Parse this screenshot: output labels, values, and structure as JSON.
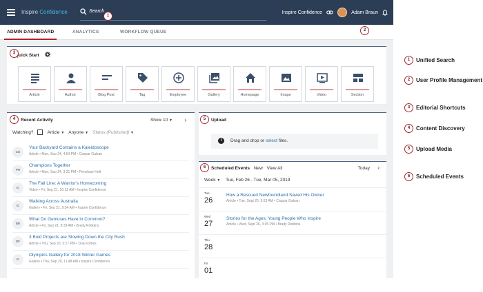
{
  "header": {
    "brand_name": "Inspire",
    "brand_accent": "Confidence",
    "search_placeholder": "Search",
    "site_name": "Inspire Confidence",
    "user_name": "Adam Braun"
  },
  "tabs": [
    {
      "label": "ADMIN DASHBOARD",
      "active": true
    },
    {
      "label": "ANALYTICS",
      "active": false
    },
    {
      "label": "WORKFLOW QUEUE",
      "active": false
    }
  ],
  "quick_start": {
    "title": "Quick Start",
    "tiles": [
      {
        "label": "Article",
        "icon": "article-icon"
      },
      {
        "label": "Author",
        "icon": "author-icon"
      },
      {
        "label": "Blog Post",
        "icon": "blog-post-icon"
      },
      {
        "label": "Tag",
        "icon": "tag-icon"
      },
      {
        "label": "Employee",
        "icon": "plus-circle-icon"
      },
      {
        "label": "Gallery",
        "icon": "gallery-icon"
      },
      {
        "label": "Homepage",
        "icon": "home-icon"
      },
      {
        "label": "Image",
        "icon": "image-icon"
      },
      {
        "label": "Video",
        "icon": "video-icon"
      },
      {
        "label": "Section",
        "icon": "section-icon"
      }
    ]
  },
  "recent_activity": {
    "title": "Recent Activity",
    "show_label": "Show 10",
    "filters": {
      "watching": "Watching?",
      "type": "Article",
      "who": "Anyone",
      "status": "Status (Published)"
    },
    "items": [
      {
        "initials": "CG",
        "title": "Your Backyard Contains a Kaleidoscope",
        "meta": "Article  •  Mon, Sep 24, 4:54 PM  •  Caspar Galvan"
      },
      {
        "initials": "PH",
        "title": "Champions Together",
        "meta": "Article  •  Mon, Sep 24, 3:21 PM  •  Penelope Holt"
      },
      {
        "initials": "IC",
        "title": "The Fall Line: A Warrior's Homecoming",
        "meta": "Video  •  Fri, Sep 21, 10:12 AM  •  Inspire Confidence"
      },
      {
        "initials": "IC",
        "title": "Walking Across Australia",
        "meta": "Gallery  •  Fri, Sep 21, 9:54 AM  •  Inspire Confidence"
      },
      {
        "initials": "BR",
        "title": "What Do Geniuses Have in Common?",
        "meta": "Article  •  Fri, Sep 21, 8:33 AM  •  Brady Robbins"
      },
      {
        "initials": "DF",
        "title": "3 Bold Projects are Slowing Down the City Rush",
        "meta": "Article  •  Thu, Sep 20, 2:17 PM  •  Dua Forbes"
      },
      {
        "initials": "IC",
        "title": "Olympics Gallery for 2018 Winter Games",
        "meta": "Gallery  •  Thu, Sep 20, 11:48 AM  •  Inspire Confidence"
      }
    ]
  },
  "upload": {
    "title": "Upload",
    "text_before": "Drag and drop or ",
    "link": "select",
    "text_after": " files."
  },
  "scheduled": {
    "title": "Scheduled Events",
    "new_label": "New",
    "view_all": "View All",
    "today": "Today",
    "range_mode": "Week",
    "range": "Tue, Feb 26 - Tue, Mar 05, 2019",
    "days": [
      {
        "dow": "Tue",
        "day": "26",
        "title": "How a Rescued Newfoundland Saved His Owner",
        "meta": "Article  •  Tue, Sept 25, 9:53 AM  •  Caspar Galvan"
      },
      {
        "dow": "Wed",
        "day": "27",
        "title": "Stories for the Ages: Young People Who Inspire",
        "meta": "Article  •  Wed, Sept 26, 3:45 PM  •  Brady Robbins"
      },
      {
        "dow": "Thu",
        "day": "28",
        "title": "",
        "meta": ""
      },
      {
        "dow": "Fri",
        "day": "01",
        "title": "",
        "meta": ""
      }
    ]
  },
  "callouts": [
    "1",
    "2",
    "3",
    "4",
    "5",
    "6"
  ],
  "legend": [
    {
      "num": "1",
      "label": "Unified Search"
    },
    {
      "num": "2",
      "label": "User Profile Management"
    },
    {
      "num": "3",
      "label": "Editorial Shortcuts"
    },
    {
      "num": "4",
      "label": "Content Discovery"
    },
    {
      "num": "5",
      "label": "Upload Media"
    },
    {
      "num": "6",
      "label": "Scheduled Events"
    }
  ],
  "colors": {
    "topbar": "#2c3e55",
    "accent": "#b0232a",
    "link": "#2b6ea8",
    "brand_accent": "#4ab5e6"
  }
}
